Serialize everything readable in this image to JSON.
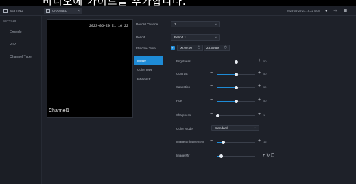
{
  "overlay_text": "비디오에 가이드를 추가합니다.",
  "titlebar": {
    "settings_tab": "SETTING",
    "channel_tab": "CHANNEL",
    "close_glyph": "×",
    "clock": "2023-05-29 21:16:22 Mon",
    "icons": [
      "user-icon",
      "logout-icon",
      "grid-icon"
    ]
  },
  "sidebar": {
    "section": "SETTING",
    "items": [
      "Encode",
      "PTZ",
      "Channel Type"
    ]
  },
  "preview": {
    "timestamp": "2023-05-29 21:16:22",
    "channel_name": "Channel1"
  },
  "form": {
    "record_channel_label": "Record Channel",
    "record_channel_value": "1",
    "period_label": "Period",
    "period_value": "Period 1",
    "effective_time_label": "Effective Time",
    "start_time": "00:00:00",
    "end_time": "23:59:59"
  },
  "subnav": [
    "Image",
    "Color Type",
    "Exposure"
  ],
  "image": {
    "sliders": [
      {
        "label": "Brightness",
        "value": 50,
        "display": "50"
      },
      {
        "label": "Contrast",
        "value": 50,
        "display": "50"
      },
      {
        "label": "Saturation",
        "value": 50,
        "display": "50"
      },
      {
        "label": "Hue",
        "value": 50,
        "display": "50"
      },
      {
        "label": "Sharpness",
        "value": 1,
        "display": "1"
      }
    ],
    "color_mode_label": "Color Mode",
    "color_mode_value": "Standard",
    "enhancement_label": "Image Enhancement",
    "enhancement_value": 16,
    "enhancement_display": "16",
    "mirror_label": "Image Mir",
    "mirror_value": 10
  },
  "colors": {
    "accent": "#1e8bd6",
    "background": "#1e2129",
    "sidebar": "#1b1e25",
    "preview": "#000000"
  }
}
